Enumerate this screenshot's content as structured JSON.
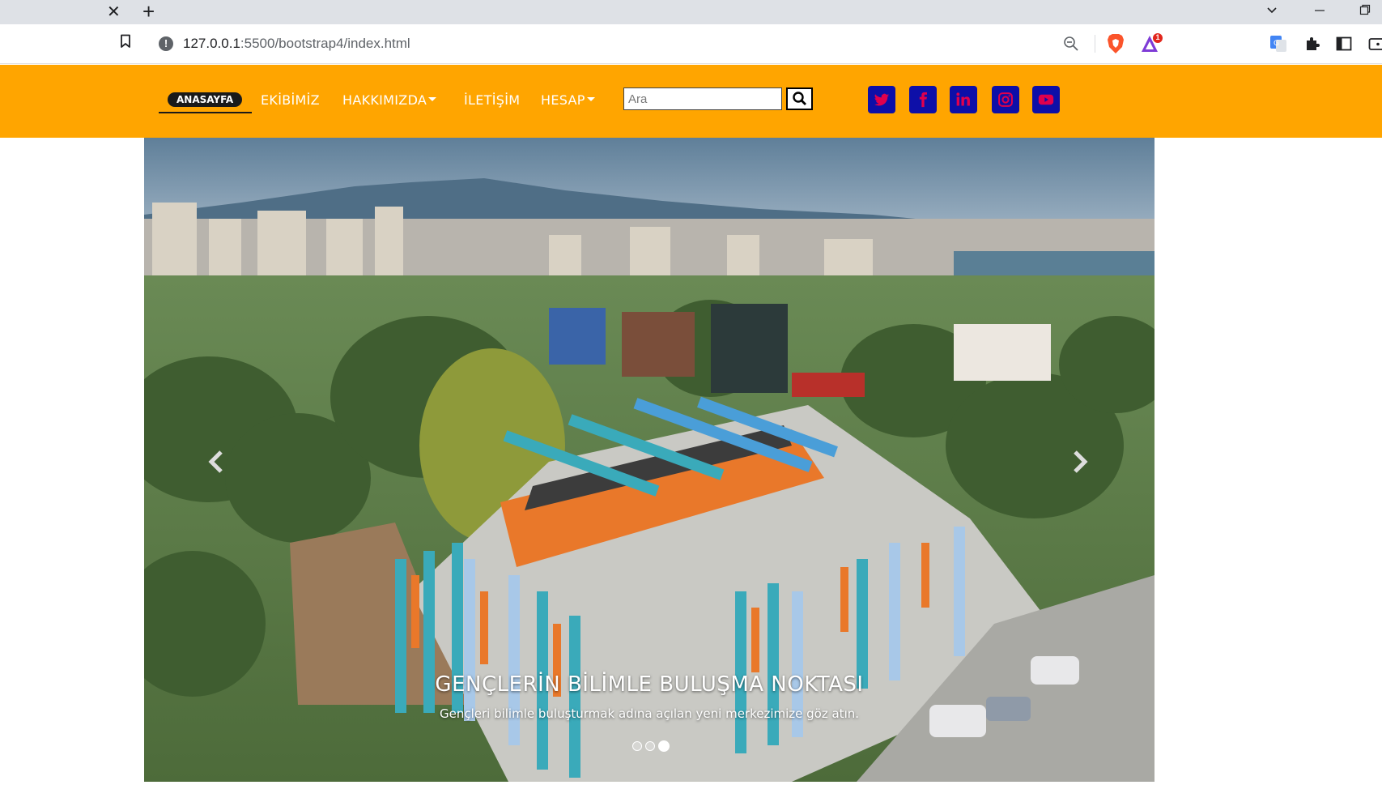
{
  "browser": {
    "tab_close_glyph": "✕",
    "new_tab_glyph": "+",
    "url_host": "127.0.0.1",
    "url_rest": ":5500/bootstrap4/index.html",
    "rewards_badge": "1"
  },
  "navbar": {
    "bg_color": "#ffa500",
    "links": {
      "home": "ANASAYFA",
      "team": "EKİBİMİZ",
      "about": "HAKKIMIZDA",
      "contact": "İLETİŞİM",
      "account": "HESAP"
    },
    "search": {
      "placeholder": "Ara",
      "value": ""
    },
    "social": [
      "twitter-icon",
      "facebook-icon",
      "linkedin-icon",
      "instagram-icon",
      "youtube-icon"
    ],
    "social_color": "#0d0fa8",
    "social_icon_color": "#e0004d"
  },
  "carousel": {
    "title": "GENÇLERİN BİLİMLE BULUŞMA NOKTASI",
    "text": "Gençleri bilimle buluşturmak adına açılan yeni merkezimize göz atın.",
    "slides_count": 3,
    "active_index": 2
  }
}
